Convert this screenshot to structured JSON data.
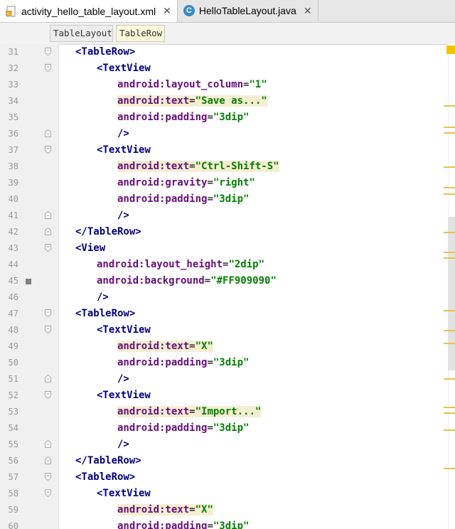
{
  "tabs": [
    {
      "label": "activity_hello_table_layout.xml",
      "icon": "xml-file-icon",
      "active": true
    },
    {
      "label": "HelloTableLayout.java",
      "icon": "java-class-icon",
      "active": false
    }
  ],
  "close_glyph": "✕",
  "class_icon_letter": "C",
  "breadcrumb": [
    "TableLayout",
    "TableRow"
  ],
  "lines": [
    {
      "n": "31",
      "text": "<TableRow>"
    },
    {
      "n": "32",
      "text": "<TextView"
    },
    {
      "n": "33",
      "text": "android:layout_column=\"1\""
    },
    {
      "n": "34",
      "text": "android:text=\"Save as...\""
    },
    {
      "n": "35",
      "text": "android:padding=\"3dip\""
    },
    {
      "n": "36",
      "text": "/>"
    },
    {
      "n": "37",
      "text": "<TextView"
    },
    {
      "n": "38",
      "text": "android:text=\"Ctrl-Shift-S\""
    },
    {
      "n": "39",
      "text": "android:gravity=\"right\""
    },
    {
      "n": "40",
      "text": "android:padding=\"3dip\""
    },
    {
      "n": "41",
      "text": "/>"
    },
    {
      "n": "42",
      "text": "</TableRow>"
    },
    {
      "n": "43",
      "text": "<View"
    },
    {
      "n": "44",
      "text": "android:layout_height=\"2dip\""
    },
    {
      "n": "45",
      "text": "android:background=\"#FF909090\""
    },
    {
      "n": "46",
      "text": "/>"
    },
    {
      "n": "47",
      "text": "<TableRow>"
    },
    {
      "n": "48",
      "text": "<TextView"
    },
    {
      "n": "49",
      "text": "android:text=\"X\""
    },
    {
      "n": "50",
      "text": "android:padding=\"3dip\""
    },
    {
      "n": "51",
      "text": "/>"
    },
    {
      "n": "52",
      "text": "<TextView"
    },
    {
      "n": "53",
      "text": "android:text=\"Import...\""
    },
    {
      "n": "54",
      "text": "android:padding=\"3dip\""
    },
    {
      "n": "55",
      "text": "/>"
    },
    {
      "n": "56",
      "text": "</TableRow>"
    },
    {
      "n": "57",
      "text": "<TableRow>"
    },
    {
      "n": "58",
      "text": "<TextView"
    },
    {
      "n": "59",
      "text": "android:text=\"X\""
    },
    {
      "n": "60",
      "text": "android:padding=\"3dip\""
    }
  ],
  "colors": {
    "tag": "#000080",
    "attribute": "#660e7a",
    "value": "#008000",
    "text_highlight": "#f5eed2",
    "marker_stripe": "#e6c24a",
    "color_swatch": "#808080"
  }
}
